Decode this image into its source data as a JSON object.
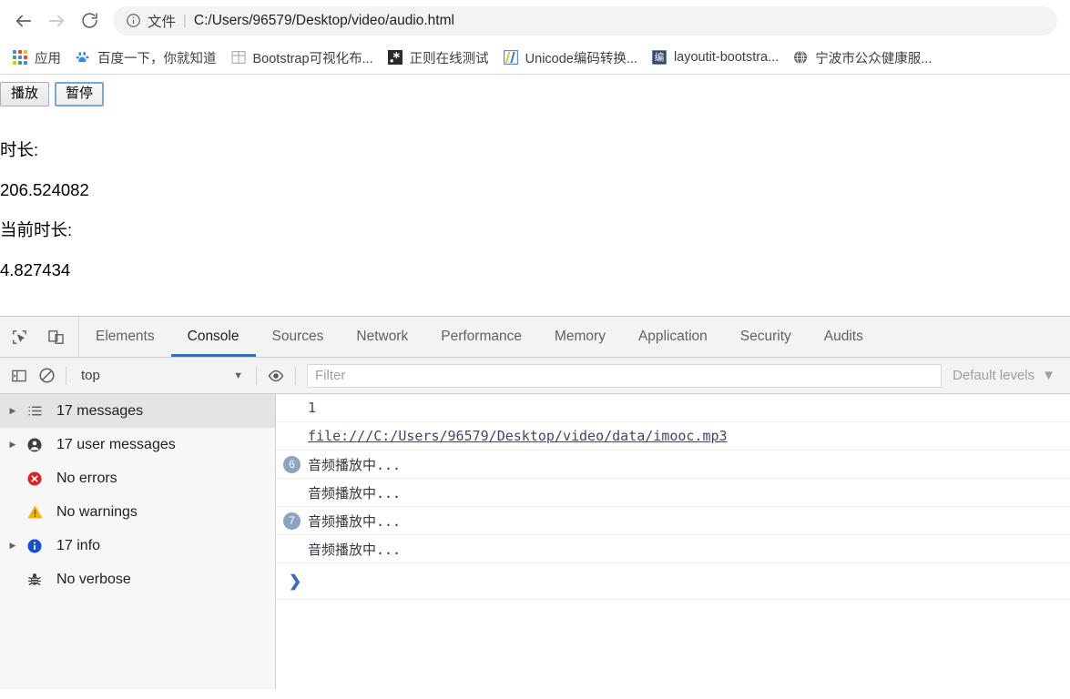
{
  "browser": {
    "nav": {
      "back_label": "Back",
      "forward_label": "Forward",
      "reload_label": "Reload"
    },
    "omnibox": {
      "info_icon": "info-circle-icon",
      "scheme_label": "文件",
      "separator": "|",
      "url": "C:/Users/96579/Desktop/video/audio.html"
    },
    "bookmarks": [
      {
        "label": "应用",
        "icon": "apps-grid-icon"
      },
      {
        "label": "百度一下，你就知道",
        "icon": "baidu-paw-icon"
      },
      {
        "label": "Bootstrap可视化布...",
        "icon": "bootstrap-grid-icon"
      },
      {
        "label": "正则在线测试",
        "icon": "regex-asterisk-icon"
      },
      {
        "label": "Unicode编码转换...",
        "icon": "unicode-convert-icon"
      },
      {
        "label": "layoutit-bootstra...",
        "icon": "bian-square-icon"
      },
      {
        "label": "宁波市公众健康服...",
        "icon": "globe-icon"
      }
    ]
  },
  "page": {
    "buttons": [
      {
        "label": "播放",
        "focused": false
      },
      {
        "label": "暂停",
        "focused": true
      }
    ],
    "lines": [
      "时长:",
      "206.524082",
      "当前时长:",
      "4.827434"
    ]
  },
  "devtools": {
    "tool_icons": [
      {
        "name": "inspect-element-icon"
      },
      {
        "name": "device-toolbar-icon"
      }
    ],
    "tabs": [
      {
        "label": "Elements",
        "active": false
      },
      {
        "label": "Console",
        "active": true
      },
      {
        "label": "Sources",
        "active": false
      },
      {
        "label": "Network",
        "active": false
      },
      {
        "label": "Performance",
        "active": false
      },
      {
        "label": "Memory",
        "active": false
      },
      {
        "label": "Application",
        "active": false
      },
      {
        "label": "Security",
        "active": false
      },
      {
        "label": "Audits",
        "active": false
      }
    ],
    "filterbar": {
      "sidebar_toggle_icon": "show-console-sidebar-icon",
      "clear_icon": "clear-console-icon",
      "context_value": "top",
      "context_caret": "▼",
      "eye_icon": "live-expression-eye-icon",
      "filter_value": "",
      "filter_placeholder": "Filter",
      "levels_label": "Default levels",
      "levels_caret": "▼"
    },
    "sidebar": [
      {
        "label": "17 messages",
        "icon": "list-messages-icon",
        "arrow": true,
        "selected": true
      },
      {
        "label": "17 user messages",
        "icon": "user-messages-icon",
        "arrow": true,
        "selected": false
      },
      {
        "label": "No errors",
        "icon": "error-icon",
        "arrow": false,
        "selected": false
      },
      {
        "label": "No warnings",
        "icon": "warning-icon",
        "arrow": false,
        "selected": false
      },
      {
        "label": "17 info",
        "icon": "info-icon",
        "arrow": true,
        "selected": false
      },
      {
        "label": "No verbose",
        "icon": "bug-verbose-icon",
        "arrow": false,
        "selected": false
      }
    ],
    "console_messages": [
      {
        "badge": "",
        "text": "1",
        "kind": "numeric"
      },
      {
        "badge": "",
        "text": "file:///C:/Users/96579/Desktop/video/data/imooc.mp3",
        "kind": "link"
      },
      {
        "badge": "6",
        "text": "音频播放中...",
        "kind": "cjk"
      },
      {
        "badge": "",
        "text": "音频播放中...",
        "kind": "cjk"
      },
      {
        "badge": "7",
        "text": "音频播放中...",
        "kind": "cjk"
      },
      {
        "badge": "",
        "text": "音频播放中...",
        "kind": "cjk"
      }
    ],
    "prompt_caret": "❯"
  },
  "colors": {
    "accent": "#1a73e8",
    "omnibox_bg": "#f1f3f4",
    "badge_bg": "#8ba4c4",
    "error": "#e02020",
    "warning": "#f5b400",
    "info": "#1a73e8",
    "link": "#3b4a6b"
  }
}
